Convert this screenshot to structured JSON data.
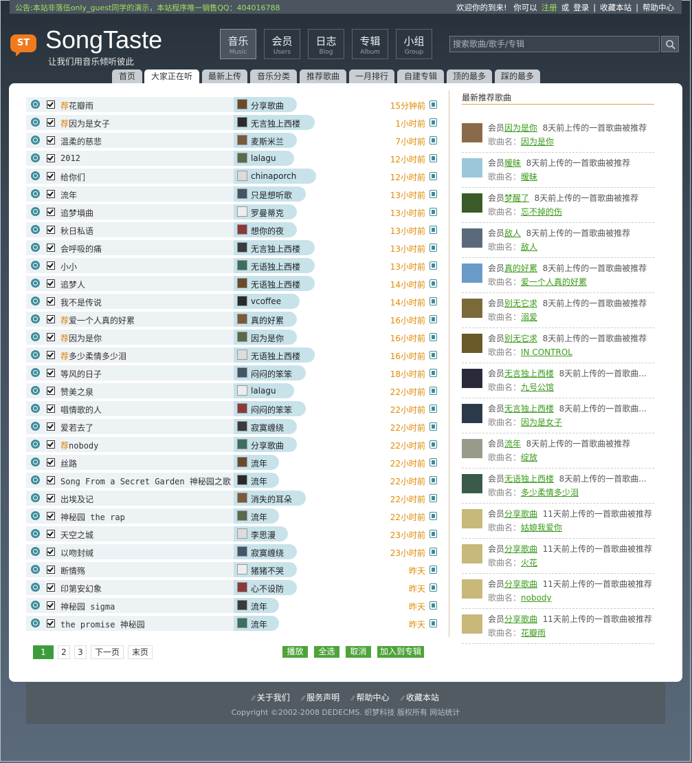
{
  "topbar": {
    "notice": "公告:本站非落伍only_guest同学的演示，本站程序唯一销售QQ：404016788",
    "welcome": "欢迎你的到来!",
    "you_can": "你可以",
    "register": "注册",
    "or": "或",
    "login": "登录",
    "sep": "|",
    "bookmark": "收藏本站",
    "help": "帮助中心"
  },
  "logo": {
    "badge": "ST",
    "name": "SongTaste",
    "slogan": "让我们用音乐倾听彼此"
  },
  "nav": [
    {
      "cn": "音乐",
      "en": "Music"
    },
    {
      "cn": "会员",
      "en": "Users"
    },
    {
      "cn": "日志",
      "en": "Blog"
    },
    {
      "cn": "专辑",
      "en": "Album"
    },
    {
      "cn": "小组",
      "en": "Group"
    }
  ],
  "search": {
    "placeholder": "搜索歌曲/歌手/专辑"
  },
  "tabs": [
    "首页",
    "大家正在听",
    "最新上传",
    "音乐分类",
    "推荐歌曲",
    "一月排行",
    "自建专辑",
    "顶的最多",
    "踩的最多"
  ],
  "songs": [
    {
      "rec": "荐",
      "title": "花瓣雨",
      "user": "分享歌曲",
      "time": "15分钟前"
    },
    {
      "rec": "荐",
      "title": "因为是女子",
      "user": "无言独上西楼",
      "time": "1小时前"
    },
    {
      "rec": "",
      "title": "温柔的慈悲",
      "user": "麦斯米兰",
      "time": "7小时前"
    },
    {
      "rec": "",
      "title": "2012",
      "user": "lalagu",
      "time": "12小时前"
    },
    {
      "rec": "",
      "title": "给你们",
      "user": "chinaporch",
      "time": "12小时前"
    },
    {
      "rec": "",
      "title": "流年",
      "user": "只是想听歌",
      "time": "13小时前"
    },
    {
      "rec": "",
      "title": "追梦塤曲",
      "user": "罗曼蒂克",
      "time": "13小时前"
    },
    {
      "rec": "",
      "title": "秋日私语",
      "user": "想你的夜",
      "time": "13小时前"
    },
    {
      "rec": "",
      "title": "会呼吸的痛",
      "user": "无言独上西楼",
      "time": "13小时前"
    },
    {
      "rec": "",
      "title": "小小",
      "user": "无语独上西楼",
      "time": "13小时前"
    },
    {
      "rec": "",
      "title": "追梦人",
      "user": "无语独上西楼",
      "time": "14小时前"
    },
    {
      "rec": "",
      "title": "我不是传说",
      "user": "vcoffee",
      "time": "14小时前"
    },
    {
      "rec": "荐",
      "title": "爱一个人真的好累",
      "user": "真的好累",
      "time": "16小时前"
    },
    {
      "rec": "荐",
      "title": "因为是你",
      "user": "因为是你",
      "time": "16小时前"
    },
    {
      "rec": "荐",
      "title": "多少柔情多少泪",
      "user": "无语独上西楼",
      "time": "16小时前"
    },
    {
      "rec": "",
      "title": "等风的日子",
      "user": "闷闷的笨笨",
      "time": "18小时前"
    },
    {
      "rec": "",
      "title": "赞美之泉",
      "user": "lalagu",
      "time": "22小时前"
    },
    {
      "rec": "",
      "title": "唱情歌的人",
      "user": "闷闷的笨笨",
      "time": "22小时前"
    },
    {
      "rec": "",
      "title": "爱若去了",
      "user": "寂寞缠绕",
      "time": "22小时前"
    },
    {
      "rec": "荐",
      "title": "nobody",
      "user": "分享歌曲",
      "time": "22小时前"
    },
    {
      "rec": "",
      "title": "丝路",
      "user": "流年",
      "time": "22小时前"
    },
    {
      "rec": "",
      "title": "Song From a Secret Garden 神秘园之歌",
      "user": "流年",
      "time": "22小时前"
    },
    {
      "rec": "",
      "title": "出埃及记",
      "user": "消失的耳朵",
      "time": "22小时前"
    },
    {
      "rec": "",
      "title": "神秘园 the rap",
      "user": "流年",
      "time": "22小时前"
    },
    {
      "rec": "",
      "title": "天空之城",
      "user": "李思漫",
      "time": "23小时前"
    },
    {
      "rec": "",
      "title": "以吻封缄",
      "user": "寂寞缠绕",
      "time": "23小时前"
    },
    {
      "rec": "",
      "title": "断情殇",
      "user": "猪猪不哭",
      "time": "昨天"
    },
    {
      "rec": "",
      "title": "印第安幻象",
      "user": "心不设防",
      "time": "昨天"
    },
    {
      "rec": "",
      "title": "神秘园 sigma",
      "user": "流年",
      "time": "昨天"
    },
    {
      "rec": "",
      "title": "the promise 神秘园",
      "user": "流年",
      "time": "昨天"
    }
  ],
  "pager": {
    "pages": [
      "1",
      "2",
      "3"
    ],
    "next": "下一页",
    "last": "末页"
  },
  "actions": [
    "播放",
    "全选",
    "取消",
    "加入到专辑"
  ],
  "sidebar": {
    "title": "最新推荐歌曲",
    "member": "会员",
    "song_label": "歌曲名：",
    "items": [
      {
        "user": "因为是你",
        "ago": "8天前上传的一首歌曲被推荐",
        "song": "因为是你"
      },
      {
        "user": "暧昧",
        "ago": "8天前上传的一首歌曲被推荐",
        "song": "暧昧"
      },
      {
        "user": "梦醒了",
        "ago": "8天前上传的一首歌曲被推荐",
        "song": "忘不掉的伤"
      },
      {
        "user": "敌人",
        "ago": "8天前上传的一首歌曲被推荐",
        "song": "敌人"
      },
      {
        "user": "真的好累",
        "ago": "8天前上传的一首歌曲被推荐",
        "song": "爱一个人真的好累"
      },
      {
        "user": "别无它求",
        "ago": "8天前上传的一首歌曲被推荐",
        "song": "溺爱"
      },
      {
        "user": "别无它求",
        "ago": "8天前上传的一首歌曲被推荐",
        "song": "IN CONTROL"
      },
      {
        "user": "无言独上西楼",
        "ago": "8天前上传的一首歌曲...",
        "song": "九号公馆"
      },
      {
        "user": "无言独上西楼",
        "ago": "8天前上传的一首歌曲...",
        "song": "因为是女子"
      },
      {
        "user": "流年",
        "ago": "8天前上传的一首歌曲被推荐",
        "song": "绽放"
      },
      {
        "user": "无语独上西楼",
        "ago": "8天前上传的一首歌曲...",
        "song": "多少柔情多少泪"
      },
      {
        "user": "分享歌曲",
        "ago": "11天前上传的一首歌曲被推荐",
        "song": "姑娘我爱你"
      },
      {
        "user": "分享歌曲",
        "ago": "11天前上传的一首歌曲被推荐",
        "song": "火花"
      },
      {
        "user": "分享歌曲",
        "ago": "11天前上传的一首歌曲被推荐",
        "song": "nobody"
      },
      {
        "user": "分享歌曲",
        "ago": "11天前上传的一首歌曲被推荐",
        "song": "花瓣雨"
      }
    ]
  },
  "footer": {
    "links": [
      "关于我们",
      "服务声明",
      "帮助中心",
      "收藏本站"
    ],
    "copyright": "Copyright ©2002-2008 DEDECMS. 织梦科技 版权所有 网站统计"
  },
  "colors": {
    "accent_green": "#4ea339",
    "time_orange": "#e08a00",
    "rec_orange": "#e07b00",
    "row_teal": "#c8e2ea"
  }
}
